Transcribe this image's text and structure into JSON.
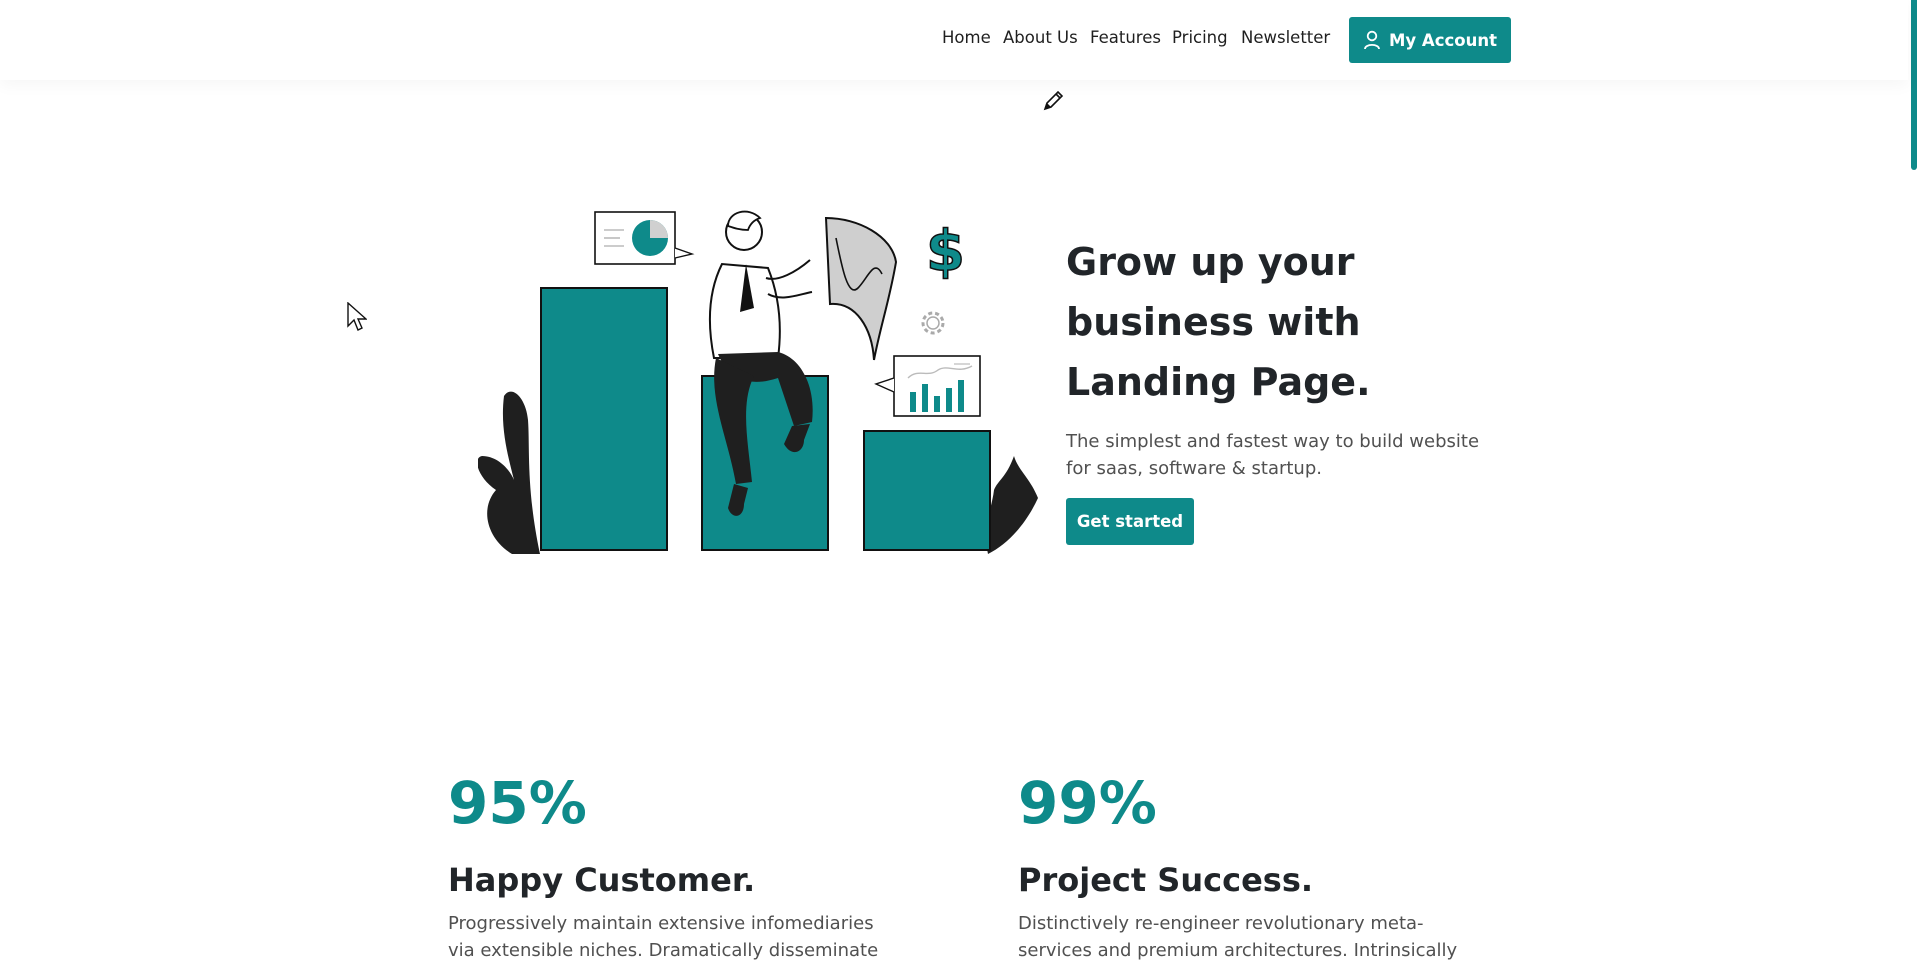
{
  "nav": {
    "items": [
      {
        "label": "Home"
      },
      {
        "label": "About Us"
      },
      {
        "label": "Features"
      },
      {
        "label": "Pricing"
      },
      {
        "label": "Newsletter"
      }
    ],
    "account_label": "My Account"
  },
  "hero": {
    "title": "Grow up your business with Landing Page.",
    "subtitle": "The simplest and fastest way to build website for saas, software & startup.",
    "cta_label": "Get started"
  },
  "stats": [
    {
      "number": "95%",
      "title": "Happy Customer.",
      "text": "Progressively maintain extensive infomediaries via extensible niches. Dramatically disseminate"
    },
    {
      "number": "99%",
      "title": "Project Success.",
      "text": "Distinctively re-engineer revolutionary meta-services and premium architectures. Intrinsically"
    }
  ],
  "icons": {
    "account": "user-icon",
    "edit": "pencil-icon",
    "cursor": "mouse-pointer-icon",
    "currency": "dollar-icon",
    "settings": "gear-icon"
  },
  "colors": {
    "accent": "#0e8a8a",
    "text": "#212529",
    "muted": "#505050"
  }
}
